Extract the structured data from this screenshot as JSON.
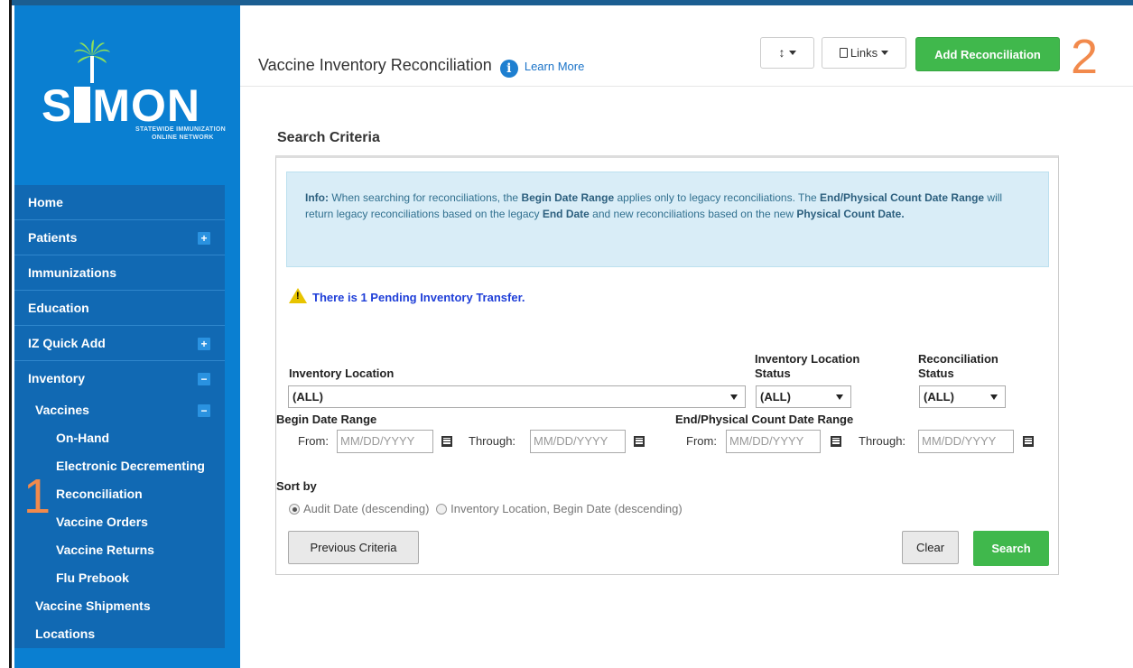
{
  "logo": {
    "word_left": "S",
    "word_right": "MON",
    "tagline_1": "STATEWIDE IMMUNIZATION",
    "tagline_2": "ONLINE NETWORK"
  },
  "sidebar": {
    "items": [
      {
        "label": "Home",
        "toggle": ""
      },
      {
        "label": "Patients",
        "toggle": "+"
      },
      {
        "label": "Immunizations",
        "toggle": ""
      },
      {
        "label": "Education",
        "toggle": ""
      },
      {
        "label": "IZ Quick Add",
        "toggle": "+"
      },
      {
        "label": "Inventory",
        "toggle": "−"
      }
    ],
    "vaccines": {
      "label": "Vaccines",
      "toggle": "−"
    },
    "vaccine_subitems": [
      "On-Hand",
      "Electronic Decrementing",
      "Reconciliation",
      "Vaccine Orders",
      "Vaccine Returns",
      "Flu Prebook"
    ],
    "inventory_subitems": [
      "Vaccine Shipments",
      "Locations"
    ]
  },
  "callouts": {
    "one": "1",
    "two": "2"
  },
  "header": {
    "title": "Vaccine Inventory Reconciliation",
    "info_glyph": "i",
    "learn_more": "Learn More",
    "sort_icon": "↕",
    "links_label": "Links",
    "add_button": "Add Reconciliation"
  },
  "search": {
    "title": "Search Criteria",
    "info_prefix": "Info:",
    "info_t1": " When searching for reconciliations, the ",
    "info_b1": "Begin Date Range",
    "info_t2": " applies only to legacy reconciliations. The ",
    "info_b2": "End/Physical Count Date Range",
    "info_t3": " will return legacy reconciliations based on the legacy ",
    "info_b3": "End Date",
    "info_t4": " and new reconciliations based on the new ",
    "info_b4": "Physical Count Date.",
    "pending": "There is 1 Pending Inventory Transfer.",
    "inv_location_label": "Inventory Location",
    "inv_location_value": "(ALL)",
    "inv_status_label_1": "Inventory Location",
    "inv_status_label_2": "Status",
    "inv_status_value": "(ALL)",
    "rec_status_label_1": "Reconciliation",
    "rec_status_label_2": "Status",
    "rec_status_value": "(ALL)",
    "begin_range_label": "Begin Date Range",
    "end_range_label": "End/Physical Count Date Range",
    "from_label": "From:",
    "through_label": "Through:",
    "date_placeholder": "MM/DD/YYYY",
    "sort_by_label": "Sort by",
    "sort_option_1": "Audit Date (descending)",
    "sort_option_2": "Inventory Location, Begin Date (descending)",
    "previous_button": "Previous Criteria",
    "clear_button": "Clear",
    "search_button": "Search"
  },
  "colors": {
    "sidebar_bg": "#0a7fd1",
    "nav_bg": "#1169b3",
    "accent_green": "#40b84c",
    "callout_orange": "#f28a4c",
    "info_bg": "#d9edf7",
    "pending_text": "#1f3fd8"
  }
}
